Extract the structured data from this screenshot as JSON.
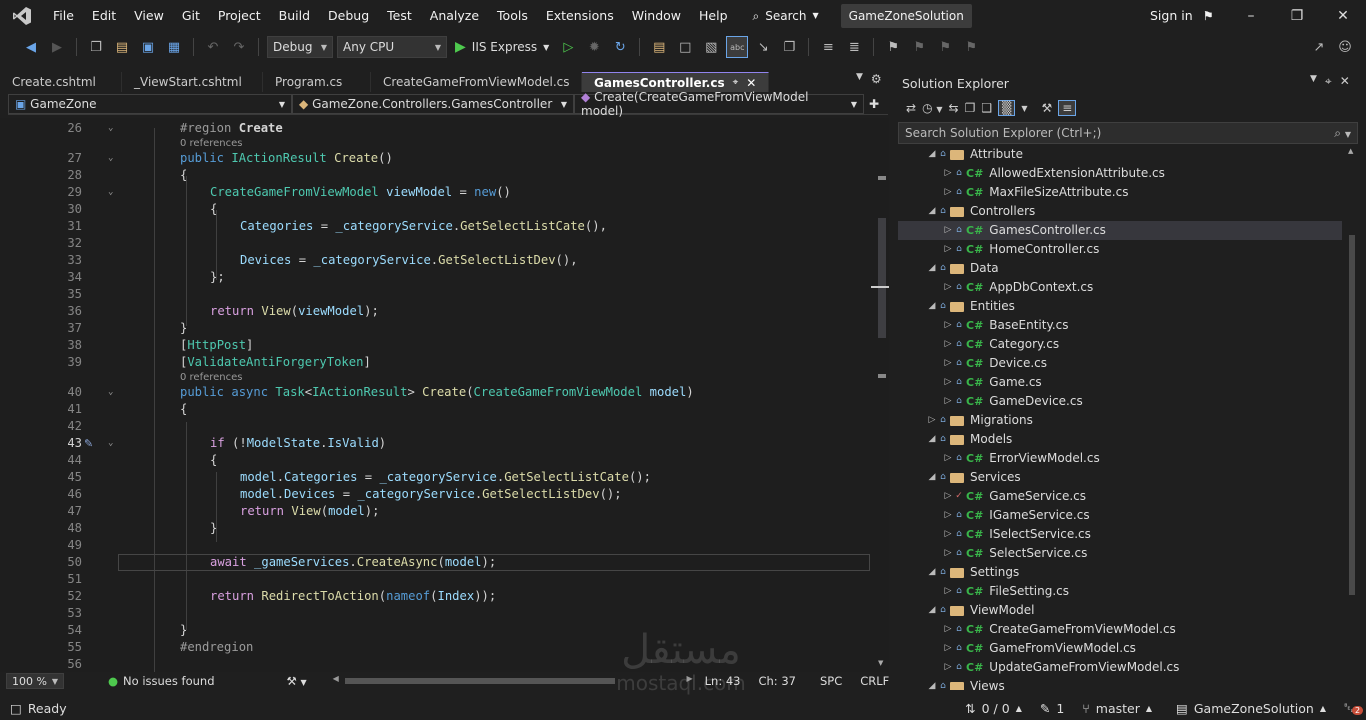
{
  "menu": {
    "items": [
      "File",
      "Edit",
      "View",
      "Git",
      "Project",
      "Build",
      "Debug",
      "Test",
      "Analyze",
      "Tools",
      "Extensions",
      "Window",
      "Help"
    ],
    "search_label": "Search",
    "solution_name": "GameZoneSolution",
    "sign_in": "Sign in"
  },
  "toolbar": {
    "config": "Debug",
    "platform": "Any CPU",
    "run_target": "IIS Express"
  },
  "tabs": {
    "items": [
      "Create.cshtml",
      "_ViewStart.cshtml",
      "Program.cs",
      "CreateGameFromViewModel.cs"
    ],
    "active": "GamesController.cs"
  },
  "navbar": {
    "project": "GameZone",
    "class": "GameZone.Controllers.GamesController",
    "member": "Create(CreateGameFromViewModel model)"
  },
  "code": {
    "references_label": "0 references",
    "lines": [
      {
        "n": "26",
        "parts": [
          [
            "gr",
            "#region "
          ],
          [
            "pl bold",
            "Create"
          ]
        ]
      },
      {
        "n": "27",
        "parts": [
          [
            "kw",
            "public "
          ],
          [
            "ty",
            "IActionResult "
          ],
          [
            "fn",
            "Create"
          ],
          [
            "pl",
            "()"
          ]
        ]
      },
      {
        "n": "28",
        "parts": [
          [
            "pl",
            "{"
          ]
        ]
      },
      {
        "n": "29",
        "parts": [
          [
            "ty",
            "CreateGameFromViewModel "
          ],
          [
            "vr",
            "viewModel "
          ],
          [
            "pl",
            "= "
          ],
          [
            "kw",
            "new"
          ],
          [
            "pl",
            "()"
          ]
        ]
      },
      {
        "n": "30",
        "parts": [
          [
            "pl",
            "{"
          ]
        ]
      },
      {
        "n": "31",
        "parts": [
          [
            "vr",
            "Categories "
          ],
          [
            "pl",
            "= "
          ],
          [
            "vr",
            "_categoryService"
          ],
          [
            "pl",
            "."
          ],
          [
            "fn",
            "GetSelectListCate"
          ],
          [
            "pl",
            "(),"
          ]
        ]
      },
      {
        "n": "32",
        "parts": []
      },
      {
        "n": "33",
        "parts": [
          [
            "vr",
            "Devices "
          ],
          [
            "pl",
            "= "
          ],
          [
            "vr",
            "_categoryService"
          ],
          [
            "pl",
            "."
          ],
          [
            "fn",
            "GetSelectListDev"
          ],
          [
            "pl",
            "(),"
          ]
        ]
      },
      {
        "n": "34",
        "parts": [
          [
            "pl",
            "};"
          ]
        ]
      },
      {
        "n": "35",
        "parts": []
      },
      {
        "n": "36",
        "parts": [
          [
            "ctl",
            "return "
          ],
          [
            "fn",
            "View"
          ],
          [
            "pl",
            "("
          ],
          [
            "vr",
            "viewModel"
          ],
          [
            "pl",
            ");"
          ]
        ]
      },
      {
        "n": "37",
        "parts": [
          [
            "pl",
            "}"
          ]
        ]
      },
      {
        "n": "38",
        "parts": [
          [
            "pl",
            "["
          ],
          [
            "ty",
            "HttpPost"
          ],
          [
            "pl",
            "]"
          ]
        ]
      },
      {
        "n": "39",
        "parts": [
          [
            "pl",
            "["
          ],
          [
            "ty",
            "ValidateAntiForgeryToken"
          ],
          [
            "pl",
            "]"
          ]
        ]
      },
      {
        "n": "40",
        "parts": [
          [
            "kw",
            "public async "
          ],
          [
            "ty",
            "Task"
          ],
          [
            "pl",
            "<"
          ],
          [
            "ty",
            "IActionResult"
          ],
          [
            "pl",
            "> "
          ],
          [
            "fn",
            "Create"
          ],
          [
            "pl",
            "("
          ],
          [
            "ty",
            "CreateGameFromViewModel "
          ],
          [
            "vr",
            "model"
          ],
          [
            "pl",
            ")"
          ]
        ]
      },
      {
        "n": "41",
        "parts": [
          [
            "pl",
            "{"
          ]
        ]
      },
      {
        "n": "42",
        "parts": []
      },
      {
        "n": "43",
        "parts": [
          [
            "ctl",
            "if "
          ],
          [
            "pl",
            "(!"
          ],
          [
            "vr",
            "ModelState"
          ],
          [
            "pl",
            "."
          ],
          [
            "vr",
            "IsValid"
          ],
          [
            "pl",
            ")"
          ]
        ]
      },
      {
        "n": "44",
        "parts": [
          [
            "pl",
            "{"
          ]
        ]
      },
      {
        "n": "45",
        "parts": [
          [
            "vr",
            "model"
          ],
          [
            "pl",
            "."
          ],
          [
            "vr",
            "Categories "
          ],
          [
            "pl",
            "= "
          ],
          [
            "vr",
            "_categoryService"
          ],
          [
            "pl",
            "."
          ],
          [
            "fn",
            "GetSelectListCate"
          ],
          [
            "pl",
            "();"
          ]
        ]
      },
      {
        "n": "46",
        "parts": [
          [
            "vr",
            "model"
          ],
          [
            "pl",
            "."
          ],
          [
            "vr",
            "Devices "
          ],
          [
            "pl",
            "= "
          ],
          [
            "vr",
            "_categoryService"
          ],
          [
            "pl",
            "."
          ],
          [
            "fn",
            "GetSelectListDev"
          ],
          [
            "pl",
            "();"
          ]
        ]
      },
      {
        "n": "47",
        "parts": [
          [
            "ctl",
            "return "
          ],
          [
            "fn",
            "View"
          ],
          [
            "pl",
            "("
          ],
          [
            "vr",
            "model"
          ],
          [
            "pl",
            ");"
          ]
        ]
      },
      {
        "n": "48",
        "parts": [
          [
            "pl",
            "}"
          ]
        ]
      },
      {
        "n": "49",
        "parts": []
      },
      {
        "n": "50",
        "parts": [
          [
            "ctl",
            "await "
          ],
          [
            "vr",
            "_gameServices"
          ],
          [
            "pl",
            "."
          ],
          [
            "fn",
            "CreateAsync"
          ],
          [
            "pl",
            "("
          ],
          [
            "vr",
            "model"
          ],
          [
            "pl",
            ");"
          ]
        ]
      },
      {
        "n": "51",
        "parts": []
      },
      {
        "n": "52",
        "parts": [
          [
            "ctl",
            "return "
          ],
          [
            "fn",
            "RedirectToAction"
          ],
          [
            "pl",
            "("
          ],
          [
            "kw",
            "nameof"
          ],
          [
            "pl",
            "("
          ],
          [
            "vr",
            "Index"
          ],
          [
            "pl",
            "));"
          ]
        ]
      },
      {
        "n": "53",
        "parts": []
      },
      {
        "n": "54",
        "parts": [
          [
            "pl",
            "}"
          ]
        ]
      },
      {
        "n": "55",
        "parts": [
          [
            "gr",
            "#endregion"
          ]
        ]
      },
      {
        "n": "56",
        "parts": []
      }
    ]
  },
  "editor_status": {
    "zoom": "100 %",
    "issues": "No issues found",
    "line": "Ln: 43",
    "col": "Ch: 37",
    "spacing": "SPC",
    "eol": "CRLF"
  },
  "solution_explorer": {
    "title": "Solution Explorer",
    "search_placeholder": "Search Solution Explorer (Ctrl+;)",
    "items": [
      {
        "label": "Attribute",
        "type": "folder",
        "depth": 1,
        "expanded": true
      },
      {
        "label": "AllowedExtensionAttribute.cs",
        "type": "cs",
        "depth": 2
      },
      {
        "label": "MaxFileSizeAttribute.cs",
        "type": "cs",
        "depth": 2
      },
      {
        "label": "Controllers",
        "type": "folder",
        "depth": 1,
        "expanded": true
      },
      {
        "label": "GamesController.cs",
        "type": "cs",
        "depth": 2,
        "selected": true
      },
      {
        "label": "HomeController.cs",
        "type": "cs",
        "depth": 2
      },
      {
        "label": "Data",
        "type": "folder",
        "depth": 1,
        "expanded": true
      },
      {
        "label": "AppDbContext.cs",
        "type": "cs",
        "depth": 2
      },
      {
        "label": "Entities",
        "type": "folder",
        "depth": 1,
        "expanded": true
      },
      {
        "label": "BaseEntity.cs",
        "type": "cs",
        "depth": 2
      },
      {
        "label": "Category.cs",
        "type": "cs",
        "depth": 2
      },
      {
        "label": "Device.cs",
        "type": "cs",
        "depth": 2
      },
      {
        "label": "Game.cs",
        "type": "cs",
        "depth": 2
      },
      {
        "label": "GameDevice.cs",
        "type": "cs",
        "depth": 2
      },
      {
        "label": "Migrations",
        "type": "folder",
        "depth": 1,
        "expanded": false
      },
      {
        "label": "Models",
        "type": "folder",
        "depth": 1,
        "expanded": true
      },
      {
        "label": "ErrorViewModel.cs",
        "type": "cs",
        "depth": 2
      },
      {
        "label": "Services",
        "type": "folder",
        "depth": 1,
        "expanded": true
      },
      {
        "label": "GameService.cs",
        "type": "cs",
        "depth": 2,
        "checked": true
      },
      {
        "label": "IGameService.cs",
        "type": "cs",
        "depth": 2
      },
      {
        "label": "ISelectService.cs",
        "type": "cs",
        "depth": 2
      },
      {
        "label": "SelectService.cs",
        "type": "cs",
        "depth": 2
      },
      {
        "label": "Settings",
        "type": "folder",
        "depth": 1,
        "expanded": true
      },
      {
        "label": "FileSetting.cs",
        "type": "cs",
        "depth": 2
      },
      {
        "label": "ViewModel",
        "type": "folder",
        "depth": 1,
        "expanded": true
      },
      {
        "label": "CreateGameFromViewModel.cs",
        "type": "cs",
        "depth": 2
      },
      {
        "label": "GameFromViewModel.cs",
        "type": "cs",
        "depth": 2
      },
      {
        "label": "UpdateGameFromViewModel.cs",
        "type": "cs",
        "depth": 2
      },
      {
        "label": "Views",
        "type": "folder",
        "depth": 1,
        "expanded": true
      }
    ]
  },
  "statusbar": {
    "ready": "Ready",
    "changes": "0 / 0",
    "pending": "1",
    "branch": "master",
    "repo": "GameZoneSolution",
    "notifications": "2"
  },
  "watermark": {
    "arabic": "مستقل",
    "latin": "mostaql.com"
  }
}
